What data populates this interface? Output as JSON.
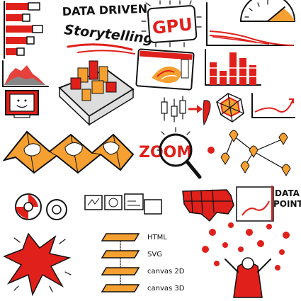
{
  "texts": {
    "title_line1": "DATA DRIVEN",
    "title_line2": "Storytelling",
    "gpu": "GPU",
    "zoom": "ZOOM",
    "data_points_line1": "DATA",
    "data_points_line2": "POINTS",
    "layer_html": "HTML",
    "layer_svg": "SVG",
    "layer_canvas2d": "canvas 2D",
    "layer_canvas3d": "canvas 3D"
  },
  "colors": {
    "accent_red": "#e0201b",
    "accent_orange": "#f5a030",
    "ink": "#111111",
    "background": "#ffffff"
  },
  "icons": [
    "horizontal-bar-chart-icon",
    "area-chart-icon",
    "computer-icon",
    "gauge-icon",
    "line-chart-icon",
    "gpu-chip-icon",
    "3d-map-icon",
    "screen-heatmap-icon",
    "bar-chart-icon",
    "candlestick-icon",
    "radar-chart-icon",
    "folded-map-icon",
    "magnifier-icon",
    "network-pins-icon",
    "flower-icon",
    "window-grid-icon",
    "us-map-icon",
    "layer-stack-icon",
    "explosion-icon",
    "person-falling-points-icon"
  ]
}
